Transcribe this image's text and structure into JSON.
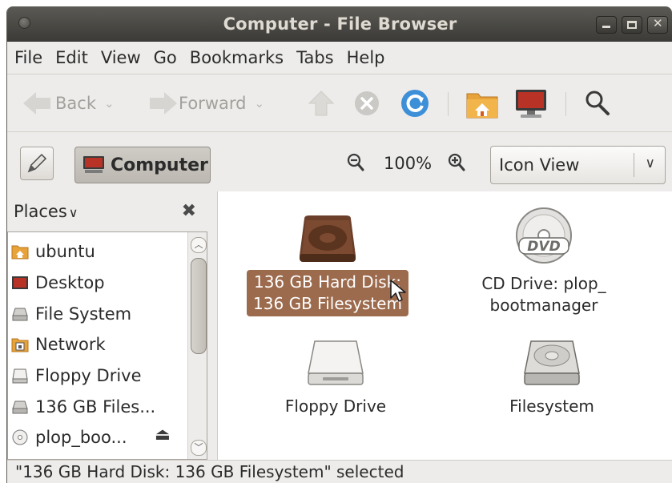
{
  "window": {
    "title": "Computer - File Browser"
  },
  "menu": [
    "File",
    "Edit",
    "View",
    "Go",
    "Bookmarks",
    "Tabs",
    "Help"
  ],
  "toolbar": {
    "back_label": "Back",
    "forward_label": "Forward"
  },
  "location": {
    "path_label": "Computer",
    "zoom": "100%",
    "view_mode": "Icon View"
  },
  "sidebar": {
    "title": "Places",
    "items": [
      {
        "label": "ubuntu",
        "icon": "home-folder-icon"
      },
      {
        "label": "Desktop",
        "icon": "desktop-icon"
      },
      {
        "label": "File System",
        "icon": "filesystem-icon"
      },
      {
        "label": "Network",
        "icon": "network-icon"
      },
      {
        "label": "Floppy Drive",
        "icon": "floppy-icon"
      },
      {
        "label": "136 GB Files...",
        "icon": "harddisk-icon"
      },
      {
        "label": "plop_boo...",
        "icon": "cd-icon"
      }
    ]
  },
  "files": [
    {
      "line1": "136 GB Hard Disk:",
      "line2": "136 GB Filesystem",
      "icon": "hard-disk-icon",
      "selected": true
    },
    {
      "line1": "CD Drive: plop_",
      "line2": "bootmanager",
      "icon": "dvd-icon",
      "selected": false
    },
    {
      "line1": "Floppy Drive",
      "line2": "",
      "icon": "floppy-drive-icon",
      "selected": false
    },
    {
      "line1": "Filesystem",
      "line2": "",
      "icon": "filesystem-drive-icon",
      "selected": false
    }
  ],
  "status": "\"136 GB Hard Disk: 136 GB Filesystem\" selected",
  "colors": {
    "selection": "#9c6a4c",
    "titlebar": "#3c3b37",
    "window_bg": "#edeceb"
  }
}
